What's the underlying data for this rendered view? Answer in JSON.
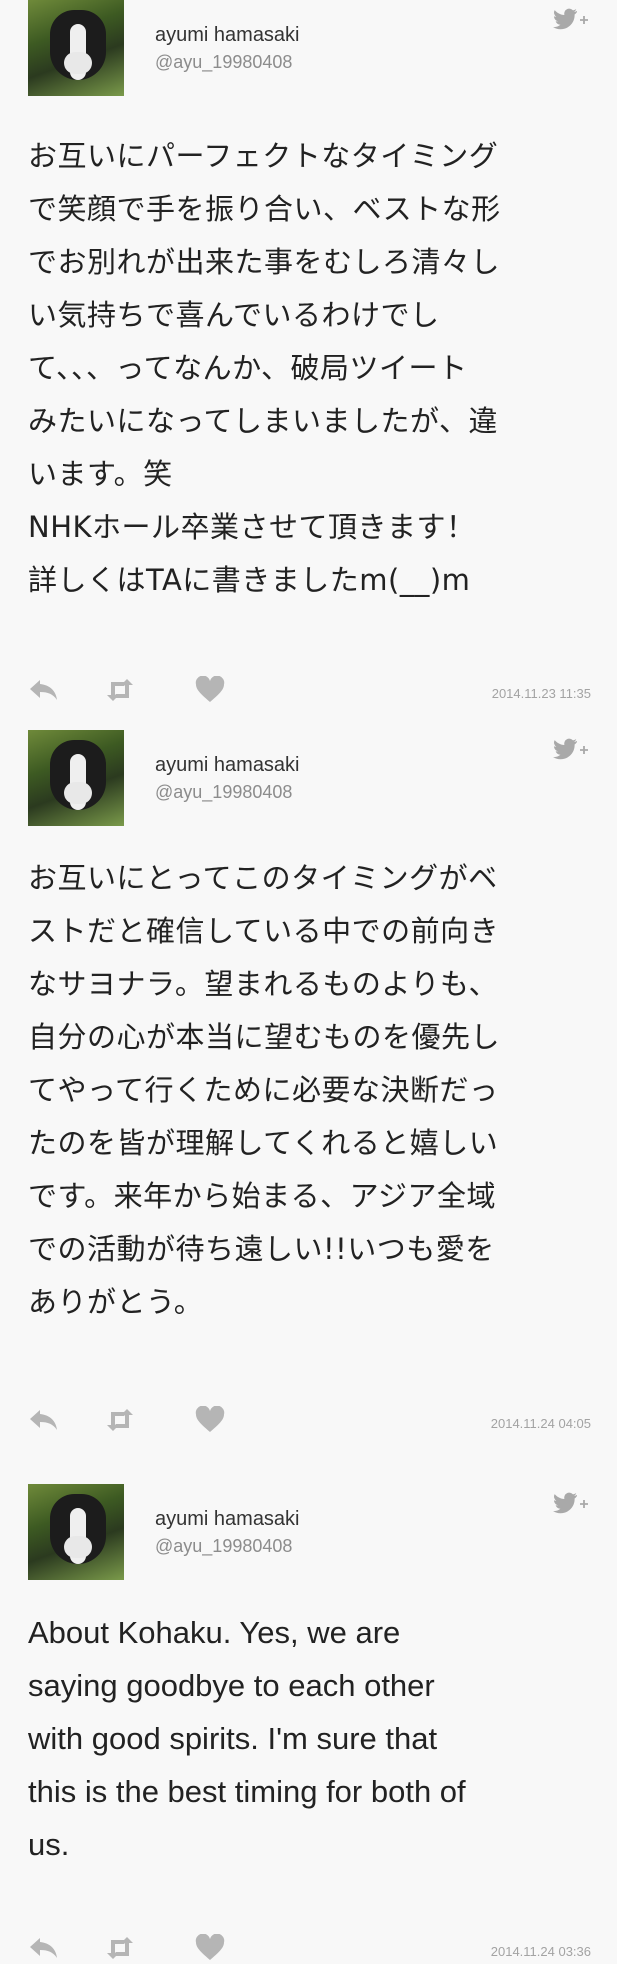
{
  "tweets": [
    {
      "name": "ayumi hamasaki",
      "handle": "@ayu_19980408",
      "text": "お互いにパーフェクトなタイミング\nで笑顔で手を振り合い、ベストな形\nでお別れが出来た事をむしろ清々し\nい気持ちで喜んでいるわけでし\nて、、、ってなんか、破局ツイート\nみたいになってしまいましたが、違\nいます。笑\nNHKホール卒業させて頂きます！\n詳しくはTAに書きましたm(__)m",
      "timestamp": "2014.11.23 11:35"
    },
    {
      "name": "ayumi hamasaki",
      "handle": "@ayu_19980408",
      "text": "お互いにとってこのタイミングがベ\nストだと確信している中での前向き\nなサヨナラ。望まれるものよりも、\n自分の心が本当に望むものを優先し\nてやって行くために必要な決断だっ\nたのを皆が理解してくれると嬉しい\nです。来年から始まる、アジア全域\nでの活動が待ち遠しい!!いつも愛を\nありがとう。",
      "timestamp": "2014.11.24 04:05"
    },
    {
      "name": "ayumi hamasaki",
      "handle": "@ayu_19980408",
      "text": "About Kohaku. Yes, we are\nsaying goodbye to each other\nwith good spirits. I'm sure that\nthis is the best timing for both of\nus.",
      "timestamp": "2014.11.24 03:36"
    }
  ],
  "icons": {
    "follow": "follow-bird-plus-icon",
    "reply": "reply-icon",
    "retweet": "retweet-icon",
    "favorite": "heart-icon"
  },
  "colors": {
    "background": "#f8f8f8",
    "icon": "#b5b5b5",
    "timestamp": "#a3a3a3"
  }
}
